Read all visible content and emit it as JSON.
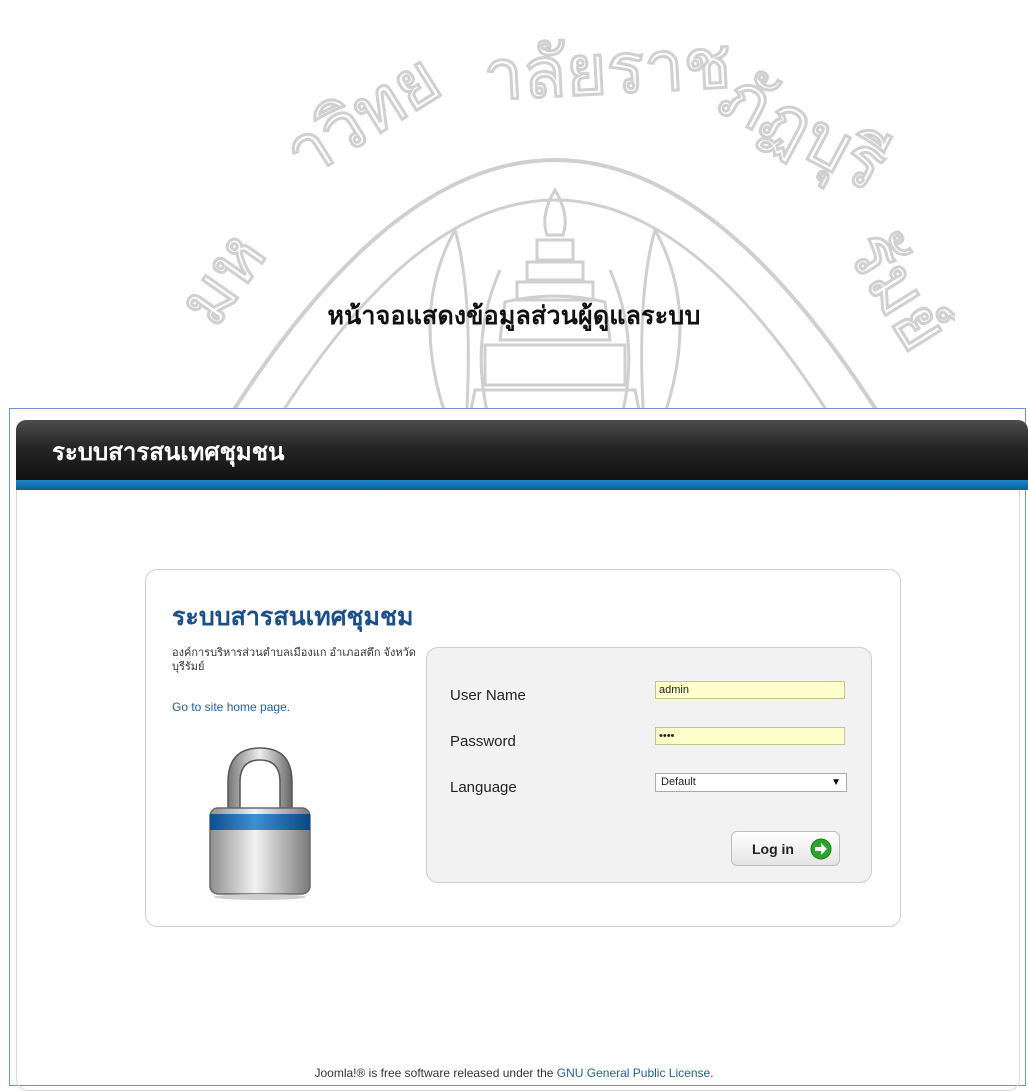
{
  "document": {
    "caption": "หน้าจอแสดงข้อมูลส่วนผู้ดูแลระบบ",
    "watermark_text": "มหาวิทยาลัยราชภัฏบุรีรัมย์"
  },
  "header": {
    "site_title": "ระบบสารสนเทศชุมชน"
  },
  "login": {
    "title": "ระบบสารสนเทศชุมชม",
    "org_description": "องค์การบริหารส่วนตำบลเมืองแก อำเภอสตึก จังหวัดบุรีรัมย์",
    "home_link": "Go to site home page.",
    "username_label": "User Name",
    "username_value": "admin",
    "password_label": "Password",
    "password_value": "••••",
    "language_label": "Language",
    "language_value": "Default",
    "login_button": "Log in"
  },
  "footer": {
    "text_before": "Joomla!® is free software released under the ",
    "license_link": "GNU General Public License",
    "text_after": "."
  },
  "colors": {
    "accent_blue": "#1b4f8a",
    "input_yellow": "#ffffcc",
    "header_dark": "#1a1a1a",
    "header_stripe": "#1d86c9"
  },
  "icons": {
    "lock": "padlock-icon",
    "login": "arrow-right-circle-icon"
  }
}
